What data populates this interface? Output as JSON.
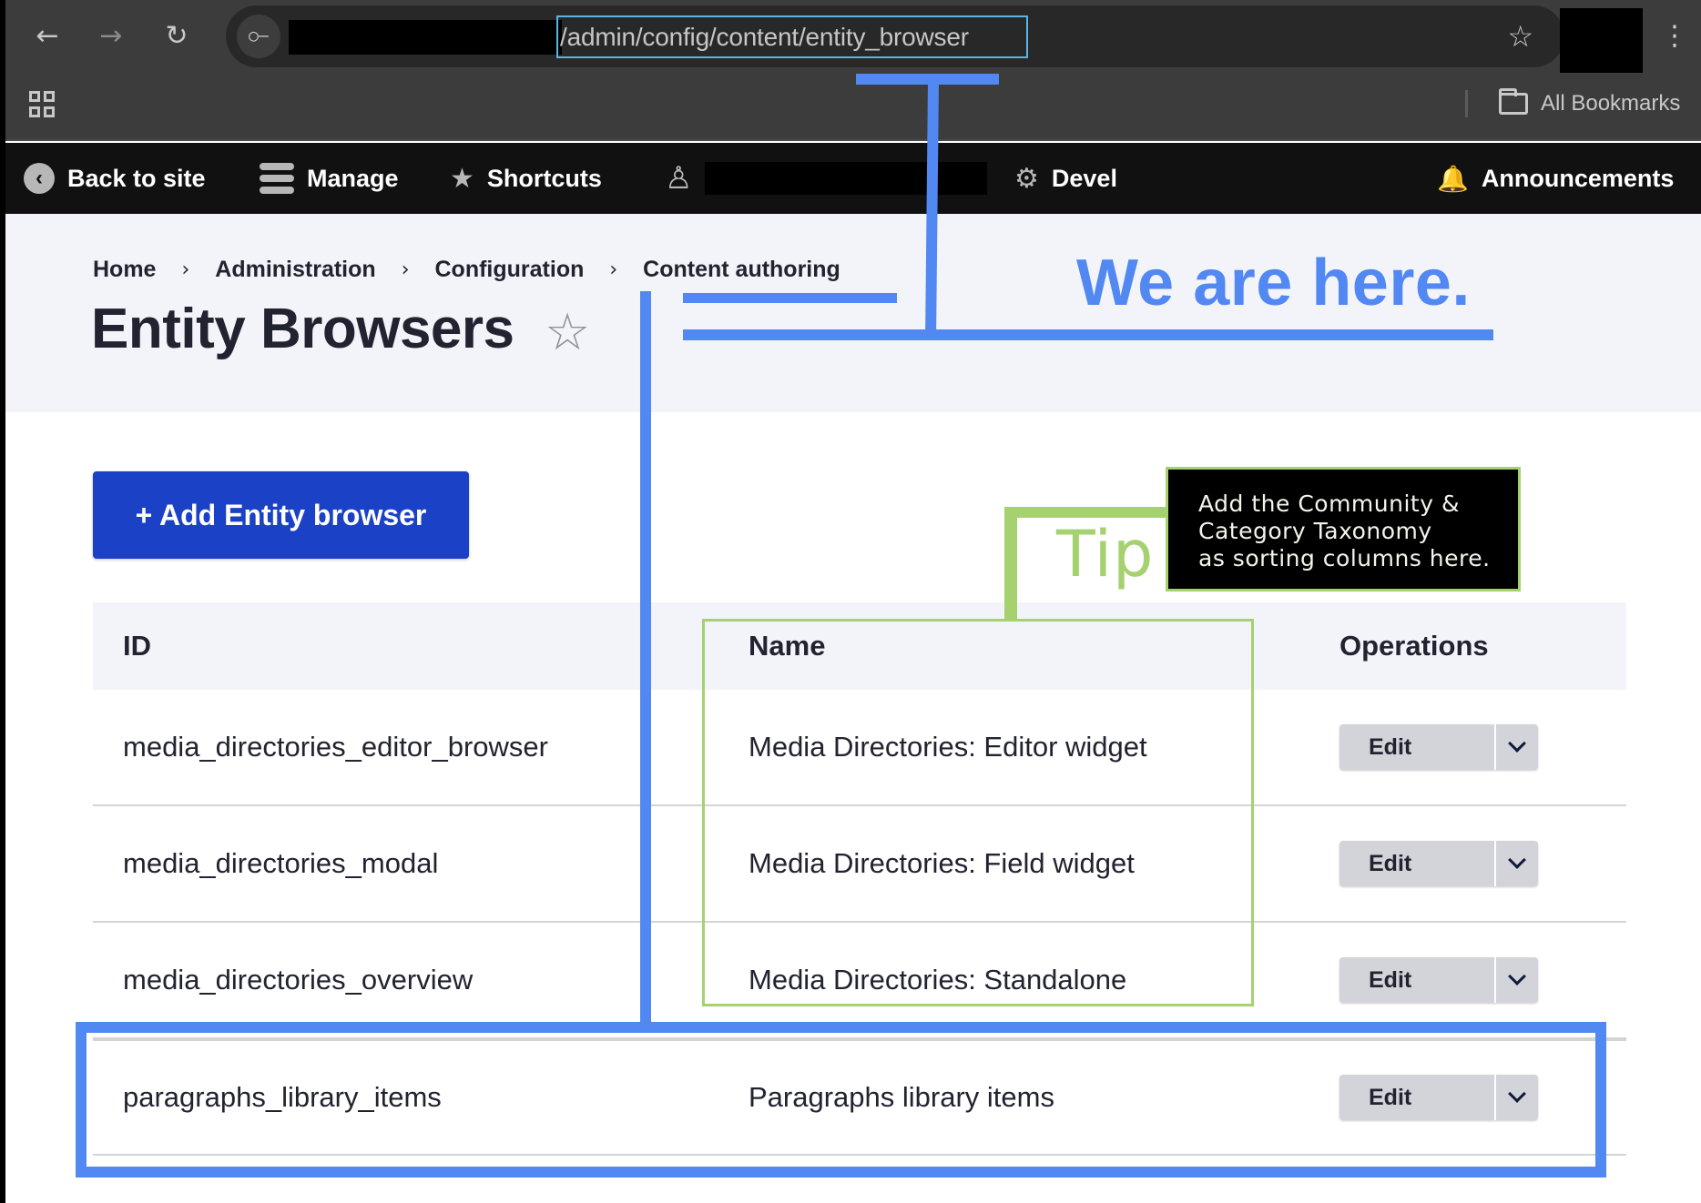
{
  "browser": {
    "back_icon": "←",
    "forward_icon": "→",
    "reload_icon": "↻",
    "site_info_icon": "⚙",
    "url_path": "/admin/config/content/entity_browser",
    "bookmark_icon": "☆",
    "menu_icon": "⋮",
    "all_bookmarks_label": "All Bookmarks"
  },
  "admin_toolbar": {
    "back_to_site": "Back to site",
    "manage": "Manage",
    "shortcuts": "Shortcuts",
    "devel": "Devel",
    "announcements": "Announcements",
    "back_icon": "‹",
    "star_icon": "★",
    "user_icon": "👤",
    "gear_icon": "⚙",
    "bell_icon": "🔔"
  },
  "breadcrumb": {
    "items": [
      "Home",
      "Administration",
      "Configuration",
      "Content authoring"
    ],
    "separator": "›"
  },
  "page": {
    "title": "Entity Browsers",
    "favorite_icon": "☆",
    "add_button": "+ Add Entity browser"
  },
  "table": {
    "headers": [
      "ID",
      "Name",
      "Operations"
    ],
    "rows": [
      {
        "id": "media_directories_editor_browser",
        "name": "Media Directories: Editor widget",
        "operation": "Edit"
      },
      {
        "id": "media_directories_modal",
        "name": "Media Directories: Field widget",
        "operation": "Edit"
      },
      {
        "id": "media_directories_overview",
        "name": "Media Directories: Standalone",
        "operation": "Edit"
      },
      {
        "id": "paragraphs_library_items",
        "name": "Paragraphs library items",
        "operation": "Edit"
      }
    ]
  },
  "annotations": {
    "we_are_here": "We are here.",
    "tip_label": "Tip",
    "tip_lines": [
      "Add the Community &",
      "Category Taxonomy",
      "as sorting columns here."
    ],
    "blue_color": "#5288f2",
    "green_color": "#a5d16f"
  }
}
